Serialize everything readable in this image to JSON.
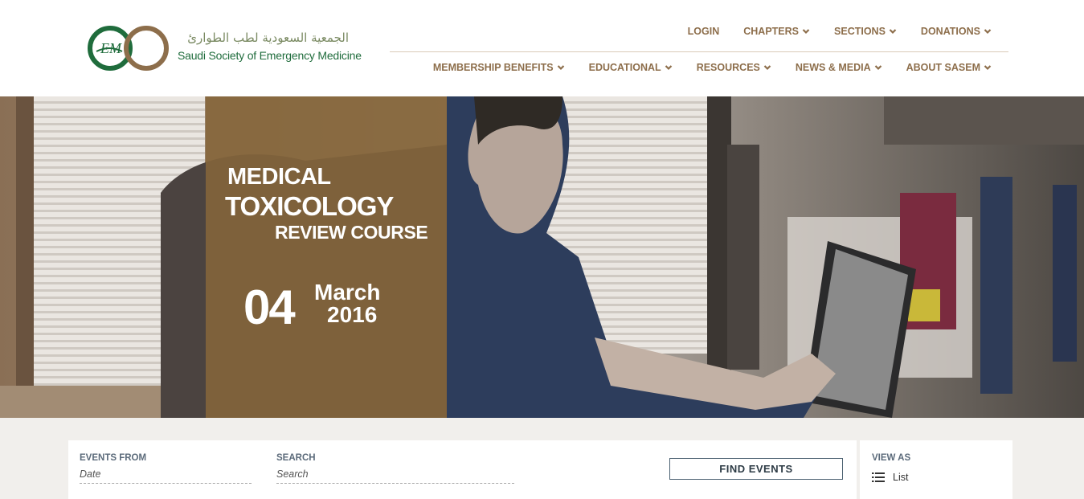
{
  "logo": {
    "arabic_text": "الجمعية السعودية لطب الطوارئ",
    "english_text": "Saudi Society of Emergency Medicine",
    "mark_text": "EM"
  },
  "nav": {
    "top": [
      {
        "label": "LOGIN",
        "dropdown": false
      },
      {
        "label": "CHAPTERS",
        "dropdown": true
      },
      {
        "label": "SECTIONS",
        "dropdown": true
      },
      {
        "label": "DONATIONS",
        "dropdown": true
      }
    ],
    "bottom": [
      {
        "label": "MEMBERSHIP BENEFITS",
        "dropdown": true
      },
      {
        "label": "EDUCATIONAL",
        "dropdown": true
      },
      {
        "label": "RESOURCES",
        "dropdown": true
      },
      {
        "label": "NEWS & MEDIA",
        "dropdown": true
      },
      {
        "label": "ABOUT SASEM",
        "dropdown": true
      }
    ]
  },
  "hero": {
    "title_line1": "MEDICAL",
    "title_line2": "TOXICOLOGY",
    "title_line3": "REVIEW COURSE",
    "day": "04",
    "month": "March",
    "year": "2016"
  },
  "events_bar": {
    "events_from_label": "EVENTS FROM",
    "events_from_placeholder": "Date",
    "search_label": "SEARCH",
    "search_placeholder": "Search",
    "find_button": "FIND EVENTS",
    "view_as_label": "VIEW AS",
    "view_as_value": "List"
  },
  "colors": {
    "brand_green": "#1f6c3c",
    "brand_gold": "#8d6e4b",
    "nav_text": "#8d6e4b",
    "panel_overlay": "#85653a"
  },
  "icons": [
    "chevron-down-icon",
    "list-icon"
  ]
}
